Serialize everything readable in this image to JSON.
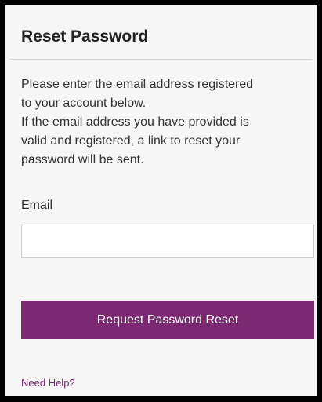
{
  "form": {
    "title": "Reset Password",
    "description_lines": [
      "Please enter the email address registered",
      "to your account below.",
      "If the email address you have provided is",
      "valid and registered, a link to reset your",
      "password will be sent."
    ],
    "email_label": "Email",
    "email_value": "",
    "email_placeholder": "",
    "submit_label": "Request Password Reset",
    "help_link": "Need Help?"
  },
  "colors": {
    "accent": "#7b2a72",
    "panel_background": "#f6f6f6",
    "frame_border": "#000000"
  }
}
